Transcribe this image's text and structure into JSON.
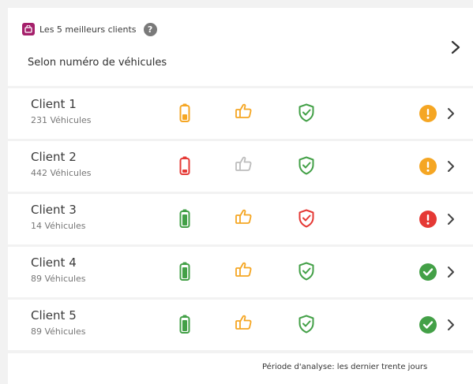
{
  "header": {
    "title": "Les 5 meilleurs clients",
    "help_icon": "?",
    "subtitle": "Selon numéro de véhicules"
  },
  "rows": [
    {
      "name": "Client 1",
      "vehicles": "231 Véhicules",
      "battery": "low",
      "thumb": "active",
      "shield": "ok",
      "status": "warning"
    },
    {
      "name": "Client 2",
      "vehicles": "442 Véhicules",
      "battery": "critical",
      "thumb": "inactive",
      "shield": "ok",
      "status": "warning"
    },
    {
      "name": "Client 3",
      "vehicles": "14 Véhicules",
      "battery": "full",
      "thumb": "active",
      "shield": "alert",
      "status": "error"
    },
    {
      "name": "Client 4",
      "vehicles": "89 Véhicules",
      "battery": "full",
      "thumb": "active",
      "shield": "ok",
      "status": "ok"
    },
    {
      "name": "Client 5",
      "vehicles": "89 Véhicules",
      "battery": "full",
      "thumb": "active",
      "shield": "ok",
      "status": "ok"
    }
  ],
  "footer": {
    "text": "Période d'analyse: les dernier trente jours"
  },
  "colors": {
    "brand": "#a5206b",
    "orange": "#f5a623",
    "red": "#e53935",
    "green": "#43a047",
    "grey": "#bdbdbd"
  }
}
